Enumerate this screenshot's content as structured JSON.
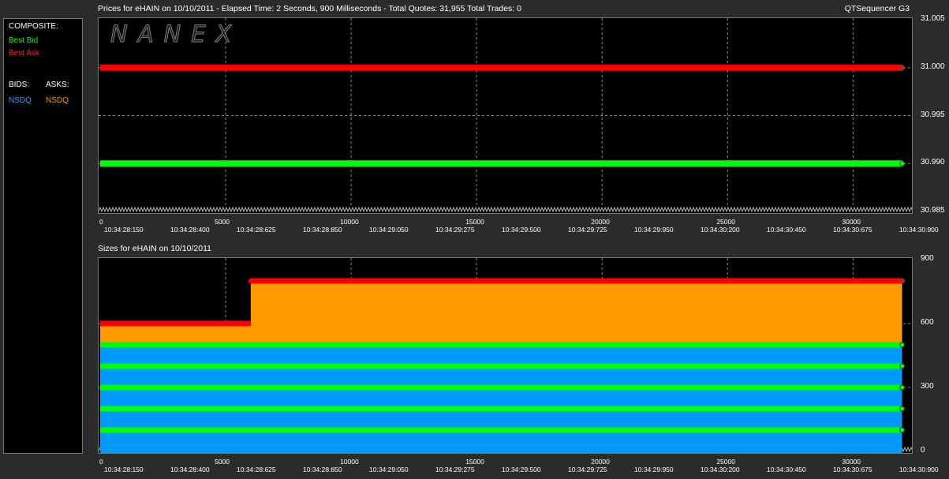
{
  "sidebar": {
    "composite_label": "COMPOSITE:",
    "best_bid_label": "Best Bid",
    "best_ask_label": "Best Ask",
    "bids_label": "BIDS:",
    "asks_label": "ASKS:",
    "bid_exchange": "NSDQ",
    "ask_exchange": "NSDQ"
  },
  "header": {
    "prices_title": "Prices for  eHAIN  on  10/10/2011  -  Elapsed Time: 2 Seconds, 900 Milliseconds  -  Total Quotes: 31,955  Total Trades: 0",
    "app_name": "QTSequencer G3",
    "sizes_title": "Sizes for  eHAIN  on  10/10/2011"
  },
  "logo_text": "NANEX",
  "colors": {
    "best_bid": "#00ff00",
    "best_ask": "#ff0000",
    "nsdq_bid": "#0099ff",
    "nsdq_ask": "#ff9900",
    "background": "#000000"
  },
  "chart_data": [
    {
      "type": "line",
      "title": "Prices for  eHAIN  on  10/10/2011",
      "xlim": [
        0,
        32000
      ],
      "ylim": [
        30.985,
        31.005
      ],
      "y_ticks": [
        "31.005",
        "31.000",
        "30.995",
        "30.990",
        "30.985"
      ],
      "x_ticks": [
        "0",
        "5000",
        "10000",
        "15000",
        "20000",
        "25000",
        "30000"
      ],
      "time_ticks": [
        "10:34:28:150",
        "10:34:28:400",
        "10:34:28:625",
        "10:34:28:850",
        "10:34:29:050",
        "10:34:29:275",
        "10:34:29:500",
        "10:34:29:725",
        "10:34:29:950",
        "10:34:30:200",
        "10:34:30:450",
        "10:34:30:675",
        "10:34:30:900"
      ],
      "series": [
        {
          "name": "Best Ask",
          "x": [
            0,
            31955
          ],
          "y": [
            31.0,
            31.0
          ]
        },
        {
          "name": "Best Bid",
          "x": [
            0,
            31955
          ],
          "y": [
            30.99,
            30.99
          ]
        }
      ],
      "grid": true
    },
    {
      "type": "area",
      "title": "Sizes for  eHAIN  on  10/10/2011",
      "xlim": [
        0,
        32000
      ],
      "ylim": [
        0,
        900
      ],
      "y_ticks": [
        "900",
        "600",
        "300",
        "0"
      ],
      "x_ticks": [
        "0",
        "5000",
        "10000",
        "15000",
        "20000",
        "25000",
        "30000"
      ],
      "time_ticks": [
        "10:34:28:150",
        "10:34:28:400",
        "10:34:28:625",
        "10:34:28:850",
        "10:34:29:050",
        "10:34:29:275",
        "10:34:29:500",
        "10:34:29:725",
        "10:34:29:950",
        "10:34:30:200",
        "10:34:30:450",
        "10:34:30:675",
        "10:34:30:900"
      ],
      "bid_size_total": 500,
      "bid_levels": [
        100,
        200,
        300,
        400,
        500
      ],
      "ask_size": {
        "x": [
          0,
          6000,
          6000,
          31955
        ],
        "y": [
          600,
          600,
          800,
          800
        ]
      },
      "grid": true
    }
  ]
}
